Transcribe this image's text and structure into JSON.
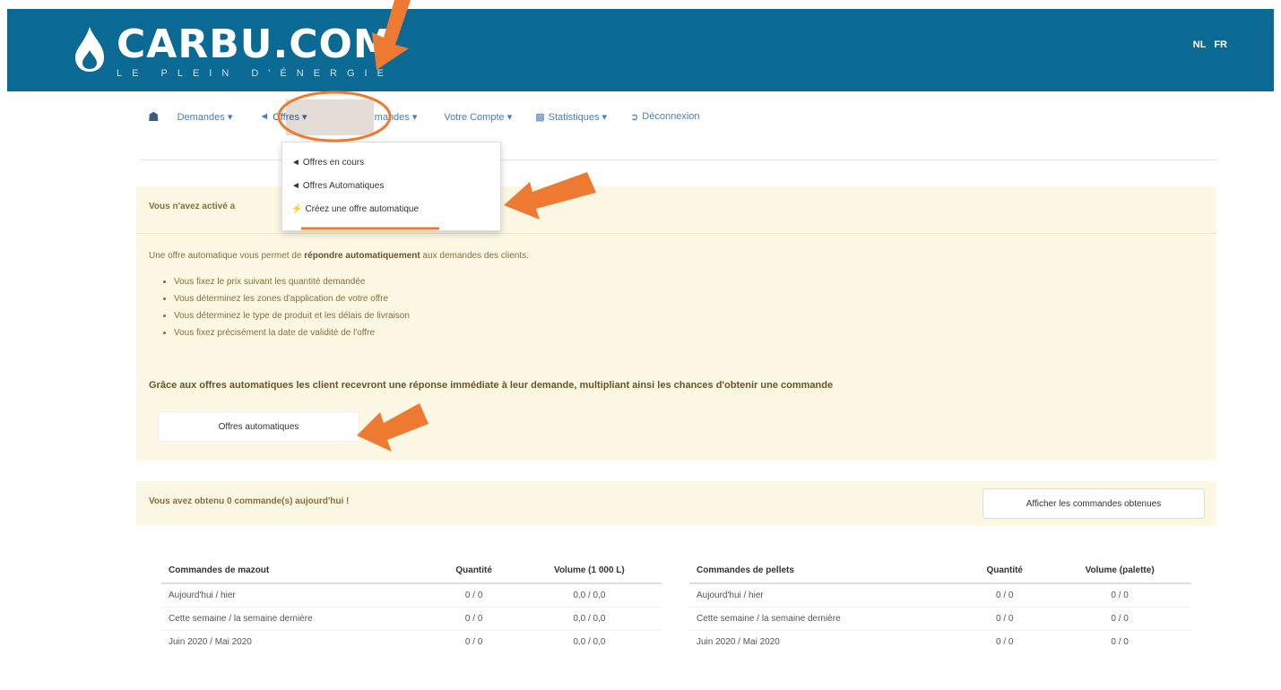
{
  "header": {
    "logo_text": "CARBU.COM",
    "logo_tagline": "LE PLEIN D'ÉNERGIE",
    "languages": [
      "NL",
      "FR"
    ]
  },
  "nav": {
    "items": [
      {
        "label": "Demandes ▾",
        "icon": "list-icon"
      },
      {
        "label": "Offres ▾",
        "icon": "bullhorn-icon"
      },
      {
        "label": "Commandes ▾",
        "icon": "cart-icon"
      },
      {
        "label": "Votre Compte ▾",
        "icon": ""
      },
      {
        "label": "Statistiques ▾",
        "icon": "bar-chart-icon"
      },
      {
        "label": "Déconnexion",
        "icon": "logout-icon"
      }
    ]
  },
  "dropdown": {
    "items": [
      {
        "label": "Offres en cours",
        "icon": "bullhorn-icon"
      },
      {
        "label": "Offres Automatiques",
        "icon": "bullhorn-icon"
      },
      {
        "label": "Créez une offre automatique",
        "icon": "bolt-icon"
      }
    ]
  },
  "info_panel": {
    "title": "Vous n'avez activé a",
    "intro_before": "Une offre automatique vous permet de ",
    "intro_bold": "répondre automatiquement",
    "intro_after": " aux demandes des clients.",
    "bullets": [
      "Vous fixez le prix suivant les quantité demandée",
      "Vous déterminez les zones d'application de votre offre",
      "Vous déterminez le type de produit et les délais de livraison",
      "Vous fixez précisément la date de validité de l'offre"
    ],
    "bold_text": "Grâce aux offres automatiques les client recevront une réponse immédiate à leur demande, multipliant ainsi les chances d'obtenir une commande",
    "button_label": "Offres automatiques"
  },
  "orders_panel": {
    "title": "Vous avez obtenu 0 commande(s) aujourd'hui !",
    "button_label": "Afficher les commandes obtenues",
    "mazout_table": {
      "headers": [
        "Commandes de mazout",
        "Quantité",
        "Volume (1 000 L)"
      ],
      "rows": [
        [
          "Aujourd'hui / hier",
          "0 / 0",
          "0,0 / 0,0"
        ],
        [
          "Cette semaine / la semaine dernière",
          "0 / 0",
          "0,0 / 0,0"
        ],
        [
          "Juin 2020 / Mai 2020",
          "0 / 0",
          "0,0 / 0,0"
        ]
      ]
    },
    "pellets_table": {
      "headers": [
        "Commandes de pellets",
        "Quantité",
        "Volume (palette)"
      ],
      "rows": [
        [
          "Aujourd'hui / hier",
          "0 / 0",
          "0 / 0"
        ],
        [
          "Cette semaine / la semaine dernière",
          "0 / 0",
          "0 / 0"
        ],
        [
          "Juin 2020 / Mai 2020",
          "0 / 0",
          "0 / 0"
        ]
      ]
    }
  },
  "colors": {
    "header_bg": "#0b6a93",
    "panel_bg": "#fcf8e3",
    "annotation_orange": "#ee7a31",
    "nav_link": "#4a7fb5"
  }
}
